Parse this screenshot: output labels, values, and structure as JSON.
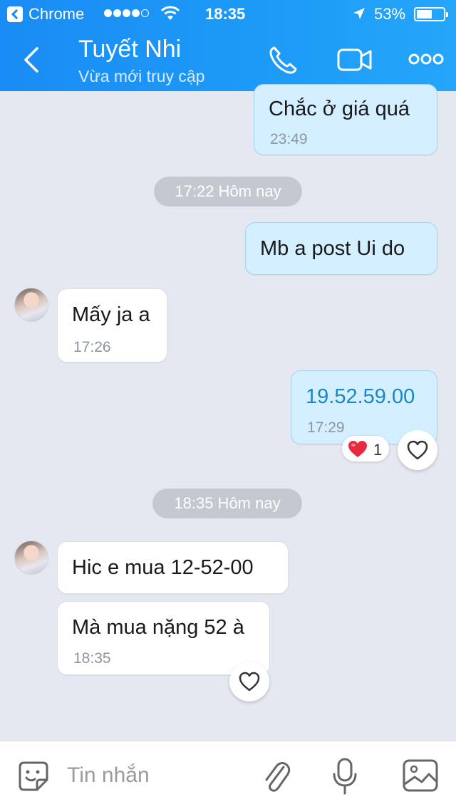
{
  "status_bar": {
    "app": "Chrome",
    "time": "18:35",
    "battery": "53%",
    "battery_level": 0.53
  },
  "header": {
    "contact_name": "Tuyết Nhi",
    "status": "Vừa mới truy cập"
  },
  "messages": {
    "m1": {
      "text": "Chắc ở giá quá",
      "time": "23:49",
      "side": "out"
    },
    "sep1": "17:22 Hôm nay",
    "m2": {
      "text": "Mb a post Ui do",
      "side": "out"
    },
    "m3": {
      "text": "Mấy ja a",
      "time": "17:26",
      "side": "in"
    },
    "m4": {
      "text": "19.52.59.00",
      "time": "17:29",
      "side": "out",
      "reaction_count": "1"
    },
    "sep2": "18:35 Hôm nay",
    "m5": {
      "text": "Hic e mua 12-52-00",
      "side": "in"
    },
    "m6": {
      "text": "Mà mua nặng 52 à",
      "time": "18:35",
      "side": "in"
    }
  },
  "composer": {
    "placeholder": "Tin nhắn"
  },
  "colors": {
    "header": "#1d9bf7",
    "chat_bg": "#e4e8f0",
    "out_bubble": "#d4efff",
    "in_bubble": "#ffffff",
    "link_number": "#1a86c8"
  },
  "icons": [
    "back-icon",
    "phone-icon",
    "video-call-icon",
    "more-icon",
    "heart-icon",
    "sticker-icon",
    "attach-icon",
    "mic-icon",
    "image-icon"
  ]
}
